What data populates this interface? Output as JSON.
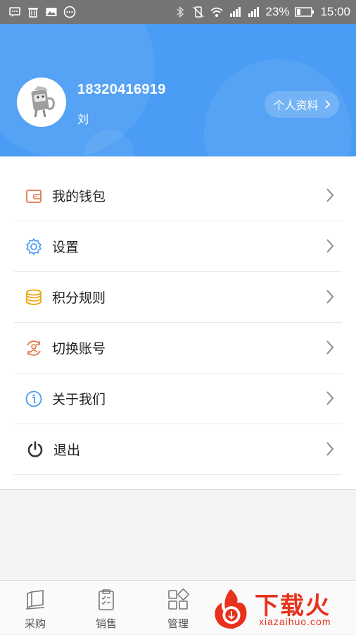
{
  "status_bar": {
    "battery_percent": "23%",
    "time": "15:00",
    "left_icons": [
      "message-icon",
      "trash-icon",
      "image-icon",
      "more-dots-icon"
    ],
    "right_icons": [
      "bluetooth-icon",
      "vibrate-icon",
      "wifi-icon",
      "signal-icon",
      "signal-icon",
      "battery-icon"
    ]
  },
  "profile": {
    "phone": "18320416919",
    "nickname": "刘",
    "edit_button": "个人资料",
    "header_color": "#4a9cf5"
  },
  "menu": {
    "items": [
      {
        "label": "我的钱包",
        "icon": "wallet-icon",
        "color": "#e0794b"
      },
      {
        "label": "设置",
        "icon": "gear-icon",
        "color": "#4a9cf5"
      },
      {
        "label": "积分规则",
        "icon": "coins-icon",
        "color": "#f0a30a"
      },
      {
        "label": "切换账号",
        "icon": "switch-account-icon",
        "color": "#e0794b"
      },
      {
        "label": "关于我们",
        "icon": "info-icon",
        "color": "#4a9cf5"
      },
      {
        "label": "退出",
        "icon": "power-icon",
        "color": "#333333"
      }
    ]
  },
  "bottom_nav": {
    "tabs": [
      {
        "label": "采购",
        "icon": "purchase-icon"
      },
      {
        "label": "销售",
        "icon": "sales-clipboard-icon"
      },
      {
        "label": "管理",
        "icon": "manage-grid-icon"
      }
    ]
  },
  "watermark": {
    "title": "下载火",
    "url": "xiazaihuo.com"
  }
}
